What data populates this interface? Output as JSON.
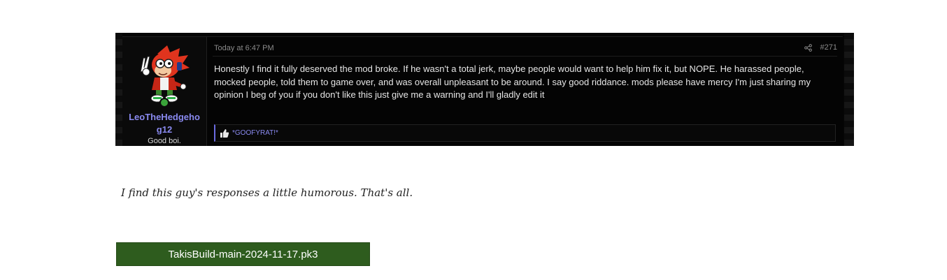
{
  "post": {
    "username": "LeoTheHedgehog12",
    "user_title": "Good boi.",
    "timestamp": "Today at 6:47 PM",
    "post_number": "#271",
    "body": "Honestly I find it fully deserved the mod broke. If he wasn't a total jerk, maybe people would want to help him fix it, but NOPE. He harassed people, mocked people, told them to game over, and was overall unpleasant to be around. I say good riddance. mods please have mercy I'm just sharing my opinion I beg of you if you don't like this just give me a warning and I'll gladly edit it",
    "reaction": "*GOOFYRAT!*",
    "reaction_icon": "thumbs-up-icon",
    "share_icon": "share-icon",
    "avatar_icon": "avatar-icon"
  },
  "comment": "I find this guy's responses a little humorous. That's all.",
  "attachment": {
    "filename": "TakisBuild-main-2024-11-17.pk3"
  },
  "colors": {
    "username": "#8a8af0",
    "attachment_bg": "#2e5c1e",
    "online": "#3aa33a"
  }
}
